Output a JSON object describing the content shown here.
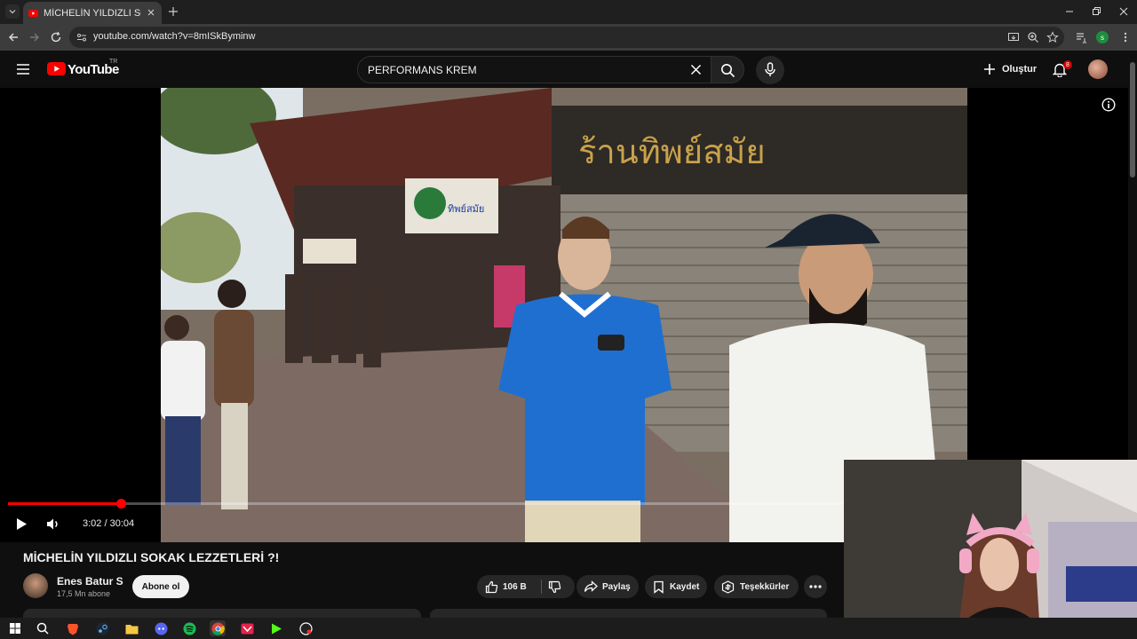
{
  "browser": {
    "tab_title": "MİCHELİN YILDIZLI SOKAK LEZZ",
    "url": "youtube.com/watch?v=8mISkByminw",
    "profile_initial": "s"
  },
  "youtube": {
    "logo": "YouTube",
    "region": "TR",
    "search_query": "PERFORMANS KREM",
    "create_label": "Oluştur",
    "notification_count": "8"
  },
  "player": {
    "time": "3:02 / 30:04",
    "progress_fraction": 0.135,
    "shop_sign_text": "ทิพย์สมัย",
    "big_sign_text": "ร้านทิพย์สมัย"
  },
  "video": {
    "title": "MİCHELİN YILDIZLI SOKAK LEZZETLERİ ?!",
    "channel": "Enes Batur S",
    "subscribers": "17,5 Mn abone",
    "subscribe_label": "Abone ol",
    "likes": "106 B",
    "share_label": "Paylaş",
    "save_label": "Kaydet",
    "thanks_label": "Teşekkürler"
  },
  "colors": {
    "brand_red": "#ff0000",
    "background": "#0f0f0f",
    "pill": "#272727"
  }
}
